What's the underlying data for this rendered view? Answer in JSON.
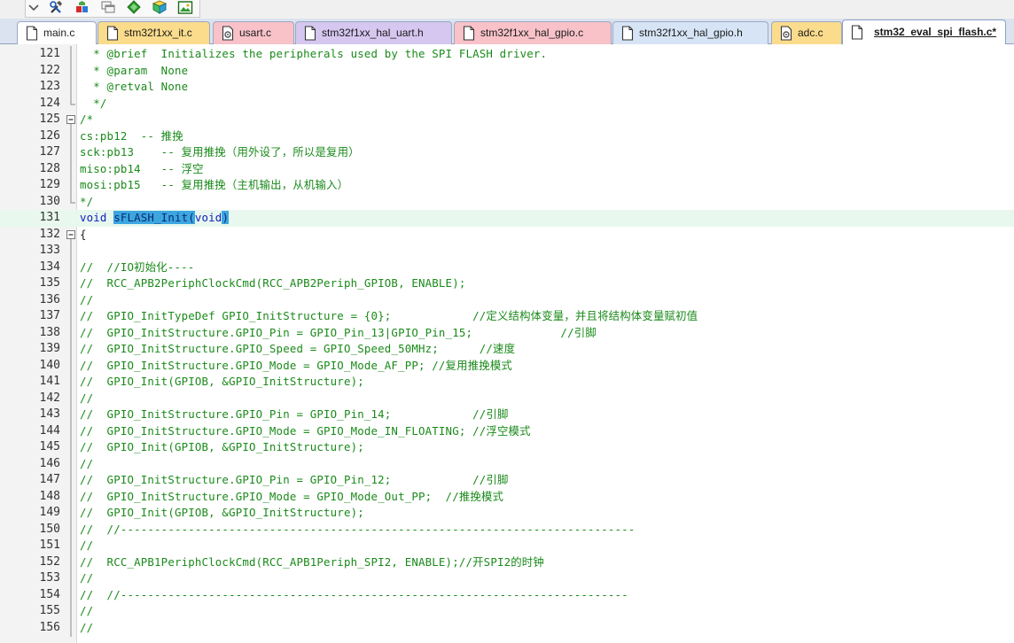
{
  "toolbar": {
    "buttons": [
      {
        "name": "dropdown-arrow-icon",
        "glyph": "chevron-down"
      },
      {
        "name": "debug-tools-icon",
        "glyph": "tools"
      },
      {
        "name": "manage-project-icon",
        "glyph": "components"
      },
      {
        "name": "window-layout-icon",
        "glyph": "windows"
      },
      {
        "name": "green-diamond-icon",
        "glyph": "diamond"
      },
      {
        "name": "pack-installer-icon",
        "glyph": "pack"
      },
      {
        "name": "image-view-icon",
        "glyph": "picture"
      }
    ]
  },
  "tabs": [
    {
      "label": "main.c",
      "icon": "doc-icon",
      "bg": "#ffffff",
      "active": false
    },
    {
      "label": "stm32f1xx_it.c",
      "icon": "doc-icon",
      "bg": "#fbdc8c",
      "active": false
    },
    {
      "label": "usart.c",
      "icon": "gear-file-icon",
      "bg": "#f8c2c8",
      "active": false
    },
    {
      "label": "stm32f1xx_hal_uart.h",
      "icon": "doc-icon",
      "bg": "#d5c7ef",
      "active": false
    },
    {
      "label": "stm32f1xx_hal_gpio.c",
      "icon": "doc-icon",
      "bg": "#f8c2c8",
      "active": false
    },
    {
      "label": "stm32f1xx_hal_gpio.h",
      "icon": "doc-icon",
      "bg": "#d6e4f5",
      "active": false
    },
    {
      "label": "adc.c",
      "icon": "gear-file-icon",
      "bg": "#fbdc8c",
      "active": false
    },
    {
      "label": "stm32_eval_spi_flash.c*",
      "icon": "doc-icon",
      "bg": "#ffffff",
      "active": true
    }
  ],
  "colors": {
    "comment": "#1a8a1a",
    "keyword": "#1020c0",
    "selection": "#3ca6e0",
    "current_line": "#e8f8ee"
  },
  "editor": {
    "current_line": 131,
    "lines": [
      {
        "n": "121",
        "fold": "bar",
        "segs": [
          {
            "t": "  * @brief  Initializes the peripherals used by the SPI FLASH driver.",
            "c": "c"
          }
        ]
      },
      {
        "n": "122",
        "fold": "bar",
        "segs": [
          {
            "t": "  * @param  None",
            "c": "c"
          }
        ]
      },
      {
        "n": "123",
        "fold": "bar",
        "segs": [
          {
            "t": "  * @retval None",
            "c": "c"
          }
        ]
      },
      {
        "n": "124",
        "fold": "end",
        "segs": [
          {
            "t": "  */",
            "c": "c"
          }
        ]
      },
      {
        "n": "125",
        "fold": "minus",
        "segs": [
          {
            "t": "/*",
            "c": "c"
          }
        ]
      },
      {
        "n": "126",
        "fold": "bar",
        "segs": [
          {
            "t": "cs:pb12  -- 推挽",
            "c": "c"
          }
        ]
      },
      {
        "n": "127",
        "fold": "bar",
        "segs": [
          {
            "t": "sck:pb13    -- 复用推挽（用外设了，所以是复用）",
            "c": "c"
          }
        ]
      },
      {
        "n": "128",
        "fold": "bar",
        "segs": [
          {
            "t": "miso:pb14   -- 浮空",
            "c": "c"
          }
        ]
      },
      {
        "n": "129",
        "fold": "bar",
        "segs": [
          {
            "t": "mosi:pb15   -- 复用推挽（主机输出，从机输入）",
            "c": "c"
          }
        ]
      },
      {
        "n": "130",
        "fold": "end",
        "segs": [
          {
            "t": "*/",
            "c": "c"
          }
        ]
      },
      {
        "n": "131",
        "fold": "",
        "segs": [
          {
            "t": "void",
            "c": "kw"
          },
          {
            "t": " ",
            "c": ""
          },
          {
            "t": "sFLASH_Init",
            "c": "sel"
          },
          {
            "t": "(",
            "c": "pr"
          },
          {
            "t": "void",
            "c": "kw"
          },
          {
            "t": ")",
            "c": "pr"
          }
        ]
      },
      {
        "n": "132",
        "fold": "minus",
        "segs": [
          {
            "t": "{",
            "c": ""
          }
        ]
      },
      {
        "n": "133",
        "fold": "bar",
        "segs": [
          {
            "t": "",
            "c": ""
          }
        ]
      },
      {
        "n": "134",
        "fold": "bar",
        "segs": [
          {
            "t": "//  //IO初始化----",
            "c": "c"
          }
        ]
      },
      {
        "n": "135",
        "fold": "bar",
        "segs": [
          {
            "t": "//  RCC_APB2PeriphClockCmd(RCC_APB2Periph_GPIOB, ENABLE);",
            "c": "c"
          }
        ]
      },
      {
        "n": "136",
        "fold": "bar",
        "segs": [
          {
            "t": "//",
            "c": "c"
          }
        ]
      },
      {
        "n": "137",
        "fold": "bar",
        "segs": [
          {
            "t": "//  GPIO_InitTypeDef GPIO_InitStructure = {0};            //定义结构体变量，并且将结构体变量赋初值",
            "c": "c"
          }
        ]
      },
      {
        "n": "138",
        "fold": "bar",
        "segs": [
          {
            "t": "//  GPIO_InitStructure.GPIO_Pin = GPIO_Pin_13|GPIO_Pin_15;             //引脚",
            "c": "c"
          }
        ]
      },
      {
        "n": "139",
        "fold": "bar",
        "segs": [
          {
            "t": "//  GPIO_InitStructure.GPIO_Speed = GPIO_Speed_50MHz;      //速度",
            "c": "c"
          }
        ]
      },
      {
        "n": "140",
        "fold": "bar",
        "segs": [
          {
            "t": "//  GPIO_InitStructure.GPIO_Mode = GPIO_Mode_AF_PP; //复用推挽模式",
            "c": "c"
          }
        ]
      },
      {
        "n": "141",
        "fold": "bar",
        "segs": [
          {
            "t": "//  GPIO_Init(GPIOB, &GPIO_InitStructure);",
            "c": "c"
          }
        ]
      },
      {
        "n": "142",
        "fold": "bar",
        "segs": [
          {
            "t": "//",
            "c": "c"
          }
        ]
      },
      {
        "n": "143",
        "fold": "bar",
        "segs": [
          {
            "t": "//  GPIO_InitStructure.GPIO_Pin = GPIO_Pin_14;            //引脚",
            "c": "c"
          }
        ]
      },
      {
        "n": "144",
        "fold": "bar",
        "segs": [
          {
            "t": "//  GPIO_InitStructure.GPIO_Mode = GPIO_Mode_IN_FLOATING; //浮空模式",
            "c": "c"
          }
        ]
      },
      {
        "n": "145",
        "fold": "bar",
        "segs": [
          {
            "t": "//  GPIO_Init(GPIOB, &GPIO_InitStructure);",
            "c": "c"
          }
        ]
      },
      {
        "n": "146",
        "fold": "bar",
        "segs": [
          {
            "t": "//",
            "c": "c"
          }
        ]
      },
      {
        "n": "147",
        "fold": "bar",
        "segs": [
          {
            "t": "//  GPIO_InitStructure.GPIO_Pin = GPIO_Pin_12;            //引脚",
            "c": "c"
          }
        ]
      },
      {
        "n": "148",
        "fold": "bar",
        "segs": [
          {
            "t": "//  GPIO_InitStructure.GPIO_Mode = GPIO_Mode_Out_PP;  //推挽模式",
            "c": "c"
          }
        ]
      },
      {
        "n": "149",
        "fold": "bar",
        "segs": [
          {
            "t": "//  GPIO_Init(GPIOB, &GPIO_InitStructure);",
            "c": "c"
          }
        ]
      },
      {
        "n": "150",
        "fold": "bar",
        "segs": [
          {
            "t": "//  //----------------------------------------------------------------------------",
            "c": "c"
          }
        ]
      },
      {
        "n": "151",
        "fold": "bar",
        "segs": [
          {
            "t": "//",
            "c": "c"
          }
        ]
      },
      {
        "n": "152",
        "fold": "bar",
        "segs": [
          {
            "t": "//  RCC_APB1PeriphClockCmd(RCC_APB1Periph_SPI2, ENABLE);//开SPI2的时钟",
            "c": "c"
          }
        ]
      },
      {
        "n": "153",
        "fold": "bar",
        "segs": [
          {
            "t": "//",
            "c": "c"
          }
        ]
      },
      {
        "n": "154",
        "fold": "bar",
        "segs": [
          {
            "t": "//  //---------------------------------------------------------------------------",
            "c": "c"
          }
        ]
      },
      {
        "n": "155",
        "fold": "bar",
        "segs": [
          {
            "t": "//",
            "c": "c"
          }
        ]
      },
      {
        "n": "156",
        "fold": "bar",
        "segs": [
          {
            "t": "//",
            "c": "c"
          }
        ]
      }
    ]
  }
}
